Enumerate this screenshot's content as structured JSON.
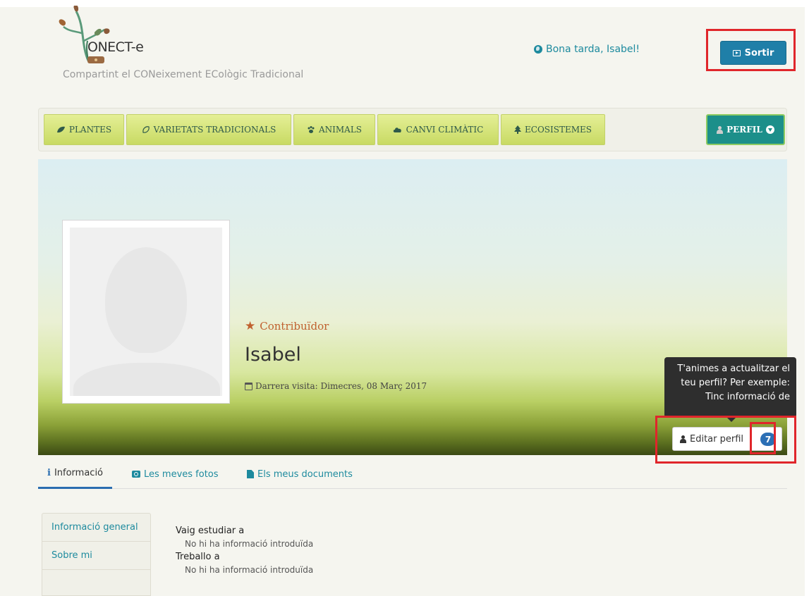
{
  "header": {
    "logo_text": "ONECT-e",
    "tagline": "Compartint el CONeixement ECològic Tradicional",
    "greeting": "Bona tarda, Isabel!",
    "logout_label": "Sortir",
    "icons": {
      "greeting": "globe-icon",
      "logout": "sign-out-icon"
    }
  },
  "nav": {
    "items": [
      {
        "label": "PLANTES",
        "icon": "leaf-icon"
      },
      {
        "label": "VARIETATS TRADICIONALS",
        "icon": "seed-icon"
      },
      {
        "label": "ANIMALS",
        "icon": "paw-icon"
      },
      {
        "label": "CANVI CLIMÀTIC",
        "icon": "cloud-icon"
      },
      {
        "label": "ECOSISTEMES",
        "icon": "tree-icon"
      }
    ],
    "profile_label": "PERFIL"
  },
  "profile": {
    "role": "Contribuïdor",
    "name": "Isabel",
    "last_visit": "Darrera visita: Dimecres, 08 Març 2017",
    "tooltip": "T'animes a actualitzar el teu perfil? Per exemple: Tinc informació de",
    "edit_label": "Editar perfil",
    "badge_count": "7"
  },
  "tabs": [
    {
      "label": "Informació",
      "active": true
    },
    {
      "label": "Les meves fotos",
      "active": false
    },
    {
      "label": "Els meus documents",
      "active": false
    }
  ],
  "sidemenu": {
    "items": [
      "Informació general",
      "Sobre mi"
    ]
  },
  "info": {
    "studied_label": "Vaig estudiar a",
    "studied_value": "No hi ha informació introduïda",
    "work_label": "Treballo a",
    "work_value": "No hi ha informació introduïda"
  },
  "colors": {
    "accent": "#1d8a9e",
    "nav_green": "#d6e47b",
    "highlight_red": "#e0262b",
    "logout_blue": "#1f7fa8"
  }
}
